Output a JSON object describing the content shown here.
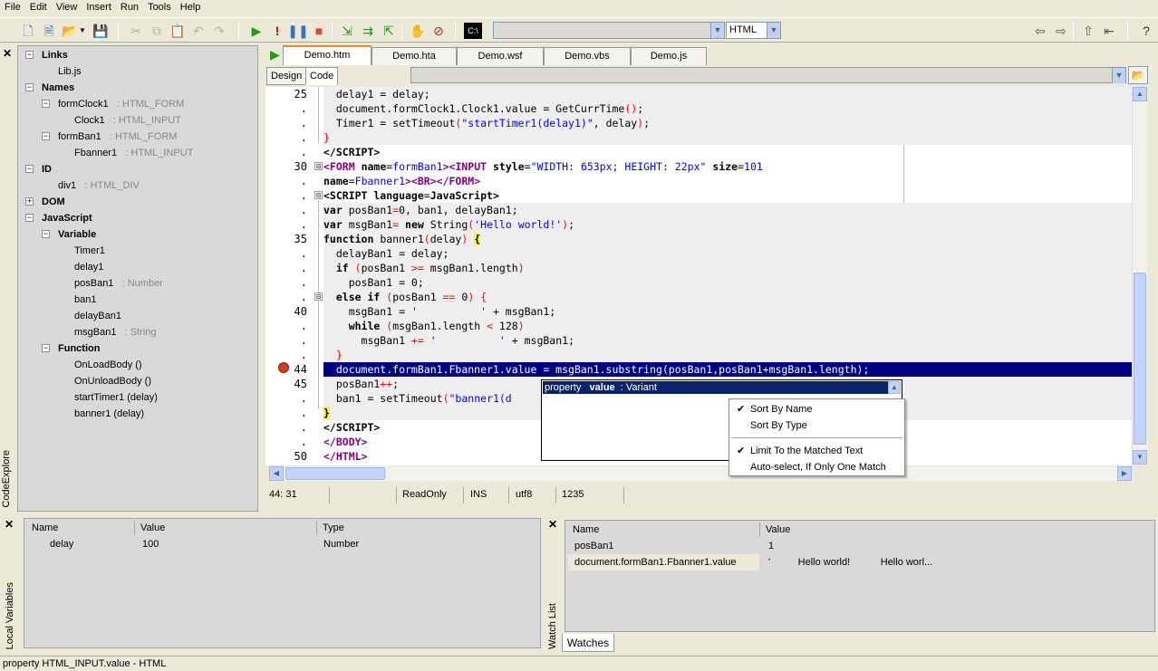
{
  "menu": [
    "File",
    "Edit",
    "View",
    "Insert",
    "Run",
    "Tools",
    "Help"
  ],
  "toolbar": {
    "language_value": "HTML",
    "terminal_label": "C:\\"
  },
  "explorer": {
    "title": "CodeExplore",
    "nodes": [
      {
        "label": "Links",
        "type": "",
        "bold": true
      },
      {
        "label": "Lib.js",
        "type": ""
      },
      {
        "label": "Names",
        "type": "",
        "bold": true
      },
      {
        "label": "formClock1",
        "type": ": HTML_FORM"
      },
      {
        "label": "Clock1",
        "type": ": HTML_INPUT"
      },
      {
        "label": "formBan1",
        "type": ": HTML_FORM"
      },
      {
        "label": "Fbanner1",
        "type": ": HTML_INPUT"
      },
      {
        "label": "ID",
        "type": "",
        "bold": true
      },
      {
        "label": "div1",
        "type": ": HTML_DIV"
      },
      {
        "label": "DOM",
        "type": "",
        "bold": true
      },
      {
        "label": "JavaScript",
        "type": "",
        "bold": true
      },
      {
        "label": "Variable",
        "type": "",
        "bold": true
      },
      {
        "label": "Timer1",
        "type": ""
      },
      {
        "label": "delay1",
        "type": ""
      },
      {
        "label": "posBan1",
        "type": ": Number"
      },
      {
        "label": "ban1",
        "type": ""
      },
      {
        "label": "delayBan1",
        "type": ""
      },
      {
        "label": "msgBan1",
        "type": ": String"
      },
      {
        "label": "Function",
        "type": "",
        "bold": true
      },
      {
        "label": "OnLoadBody  ()",
        "type": ""
      },
      {
        "label": "OnUnloadBody  ()",
        "type": ""
      },
      {
        "label": "startTimer1  (delay)",
        "type": ""
      },
      {
        "label": "banner1  (delay)",
        "type": ""
      }
    ]
  },
  "tabs": [
    "Demo.htm",
    "Demo.hta",
    "Demo.wsf",
    "Demo.vbs",
    "Demo.js"
  ],
  "subtabs": [
    "Design",
    "Code"
  ],
  "line_numbers": [
    "25",
    ".",
    ".",
    ".",
    ".",
    "30",
    ".",
    ".",
    ".",
    ".",
    "35",
    ".",
    ".",
    ".",
    ".",
    "40",
    ".",
    ".",
    ".",
    "44",
    "45",
    ".",
    ".",
    ".",
    ".",
    "50"
  ],
  "popup": {
    "row_kind": "property",
    "row_name": "value",
    "row_type": ": Variant"
  },
  "context_menu": {
    "sort_by_name": "Sort By Name",
    "sort_by_type": "Sort By Type",
    "limit": "Limit To the Matched Text",
    "autoselect": "Auto-select, If Only One Match"
  },
  "status": {
    "position": "44: 31",
    "mode": "ReadOnly",
    "ins": "INS",
    "encoding": "utf8",
    "size": "1235"
  },
  "locals": {
    "title": "Local Variables",
    "headers": [
      "Name",
      "Value",
      "Type"
    ],
    "rows": [
      {
        "name": "delay",
        "value": "100",
        "type": "Number"
      }
    ]
  },
  "watches": {
    "title": "Watch List",
    "headers": [
      "Name",
      "Value"
    ],
    "rows": [
      {
        "name": "posBan1",
        "value": "1"
      },
      {
        "name": "document.formBan1.Fbanner1.value",
        "value": "'          Hello world!           Hello worl..."
      }
    ],
    "tab": "Watches"
  },
  "bottom_status": "property  HTML_INPUT.value - HTML"
}
